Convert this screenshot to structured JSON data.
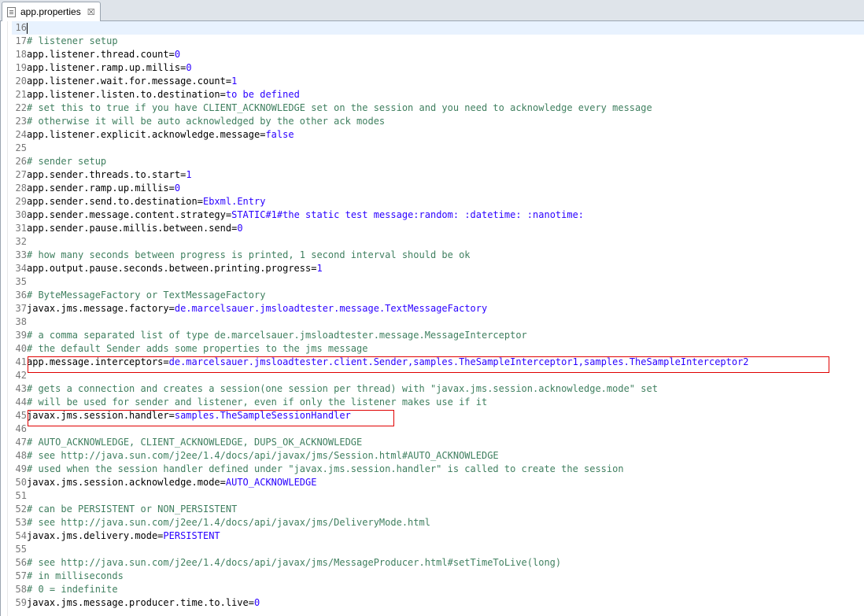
{
  "tab": {
    "title": "app.properties",
    "close_glyph": "☒"
  },
  "lines": [
    {
      "n": "16",
      "key": "",
      "sep": "",
      "val": "",
      "comment": "",
      "current": true
    },
    {
      "n": "17",
      "key": "",
      "sep": "",
      "val": "",
      "comment": "# listener setup"
    },
    {
      "n": "18",
      "key": "app.listener.thread.count",
      "sep": "=",
      "val": "0",
      "comment": ""
    },
    {
      "n": "19",
      "key": "app.listener.ramp.up.millis",
      "sep": "=",
      "val": "0",
      "comment": ""
    },
    {
      "n": "20",
      "key": "app.listener.wait.for.message.count",
      "sep": "=",
      "val": "1",
      "comment": ""
    },
    {
      "n": "21",
      "key": "app.listener.listen.to.destination",
      "sep": "=",
      "val": "to be defined",
      "comment": ""
    },
    {
      "n": "22",
      "key": "",
      "sep": "",
      "val": "",
      "comment": "# set this to true if you have CLIENT_ACKNOWLEDGE set on the session and you need to acknowledge every message"
    },
    {
      "n": "23",
      "key": "",
      "sep": "",
      "val": "",
      "comment": "# otherwise it will be auto acknowledged by the other ack modes"
    },
    {
      "n": "24",
      "key": "app.listener.explicit.acknowledge.message",
      "sep": "=",
      "val": "false",
      "comment": ""
    },
    {
      "n": "25",
      "key": "",
      "sep": "",
      "val": "",
      "comment": ""
    },
    {
      "n": "26",
      "key": "",
      "sep": "",
      "val": "",
      "comment": "# sender setup"
    },
    {
      "n": "27",
      "key": "app.sender.threads.to.start",
      "sep": "=",
      "val": "1",
      "comment": ""
    },
    {
      "n": "28",
      "key": "app.sender.ramp.up.millis",
      "sep": "=",
      "val": "0",
      "comment": ""
    },
    {
      "n": "29",
      "key": "app.sender.send.to.destination",
      "sep": "=",
      "val": "Ebxml.Entry",
      "comment": ""
    },
    {
      "n": "30",
      "key": "app.sender.message.content.strategy",
      "sep": "=",
      "val": "STATIC#1#the static test message:random: :datetime: :nanotime:",
      "comment": ""
    },
    {
      "n": "31",
      "key": "app.sender.pause.millis.between.send",
      "sep": "=",
      "val": "0",
      "comment": ""
    },
    {
      "n": "32",
      "key": "",
      "sep": "",
      "val": "",
      "comment": ""
    },
    {
      "n": "33",
      "key": "",
      "sep": "",
      "val": "",
      "comment": "# how many seconds between progress is printed, 1 second interval should be ok"
    },
    {
      "n": "34",
      "key": "app.output.pause.seconds.between.printing.progress",
      "sep": "=",
      "val": "1",
      "comment": ""
    },
    {
      "n": "35",
      "key": "",
      "sep": "",
      "val": "",
      "comment": ""
    },
    {
      "n": "36",
      "key": "",
      "sep": "",
      "val": "",
      "comment": "# ByteMessageFactory or TextMessageFactory"
    },
    {
      "n": "37",
      "key": "javax.jms.message.factory",
      "sep": "=",
      "val": "de.marcelsauer.jmsloadtester.message.TextMessageFactory",
      "comment": ""
    },
    {
      "n": "38",
      "key": "",
      "sep": "",
      "val": "",
      "comment": ""
    },
    {
      "n": "39",
      "key": "",
      "sep": "",
      "val": "",
      "comment": "# a comma separated list of type de.marcelsauer.jmsloadtester.message.MessageInterceptor"
    },
    {
      "n": "40",
      "key": "",
      "sep": "",
      "val": "",
      "comment": "# the default Sender adds some properties to the jms message"
    },
    {
      "n": "41",
      "key": "app.message.interceptors",
      "sep": "=",
      "val": "de.marcelsauer.jmsloadtester.client.Sender,samples.TheSampleInterceptor1,samples.TheSampleInterceptor2",
      "comment": ""
    },
    {
      "n": "42",
      "key": "",
      "sep": "",
      "val": "",
      "comment": ""
    },
    {
      "n": "43",
      "key": "",
      "sep": "",
      "val": "",
      "comment": "# gets a connection and creates a session(one session per thread) with \"javax.jms.session.acknowledge.mode\" set"
    },
    {
      "n": "44",
      "key": "",
      "sep": "",
      "val": "",
      "comment": "# will be used for sender and listener, even if only the listener makes use if it"
    },
    {
      "n": "45",
      "key": "javax.jms.session.handler",
      "sep": "=",
      "val": "samples.TheSampleSessionHandler",
      "comment": ""
    },
    {
      "n": "46",
      "key": "",
      "sep": "",
      "val": "",
      "comment": ""
    },
    {
      "n": "47",
      "key": "",
      "sep": "",
      "val": "",
      "comment": "# AUTO_ACKNOWLEDGE, CLIENT_ACKNOWLEDGE, DUPS_OK_ACKNOWLEDGE"
    },
    {
      "n": "48",
      "key": "",
      "sep": "",
      "val": "",
      "comment": "# see http://java.sun.com/j2ee/1.4/docs/api/javax/jms/Session.html#AUTO_ACKNOWLEDGE"
    },
    {
      "n": "49",
      "key": "",
      "sep": "",
      "val": "",
      "comment": "# used when the session handler defined under \"javax.jms.session.handler\" is called to create the session"
    },
    {
      "n": "50",
      "key": "javax.jms.session.acknowledge.mode",
      "sep": "=",
      "val": "AUTO_ACKNOWLEDGE",
      "comment": ""
    },
    {
      "n": "51",
      "key": "",
      "sep": "",
      "val": "",
      "comment": ""
    },
    {
      "n": "52",
      "key": "",
      "sep": "",
      "val": "",
      "comment": "# can be PERSISTENT or NON_PERSISTENT"
    },
    {
      "n": "53",
      "key": "",
      "sep": "",
      "val": "",
      "comment": "# see http://java.sun.com/j2ee/1.4/docs/api/javax/jms/DeliveryMode.html"
    },
    {
      "n": "54",
      "key": "javax.jms.delivery.mode",
      "sep": "=",
      "val": "PERSISTENT",
      "comment": ""
    },
    {
      "n": "55",
      "key": "",
      "sep": "",
      "val": "",
      "comment": ""
    },
    {
      "n": "56",
      "key": "",
      "sep": "",
      "val": "",
      "comment": "# see http://java.sun.com/j2ee/1.4/docs/api/javax/jms/MessageProducer.html#setTimeToLive(long)"
    },
    {
      "n": "57",
      "key": "",
      "sep": "",
      "val": "",
      "comment": "# in milliseconds"
    },
    {
      "n": "58",
      "key": "",
      "sep": "",
      "val": "",
      "comment": "# 0 = indefinite"
    },
    {
      "n": "59",
      "key": "javax.jms.message.producer.time.to.live",
      "sep": "=",
      "val": "0",
      "comment": ""
    }
  ],
  "colors": {
    "key": "#000000",
    "value": "#2a00ff",
    "comment": "#3f7f5f",
    "line_number": "#787878",
    "current_line": "#e8f2fe",
    "highlight_box": "#e00000"
  }
}
